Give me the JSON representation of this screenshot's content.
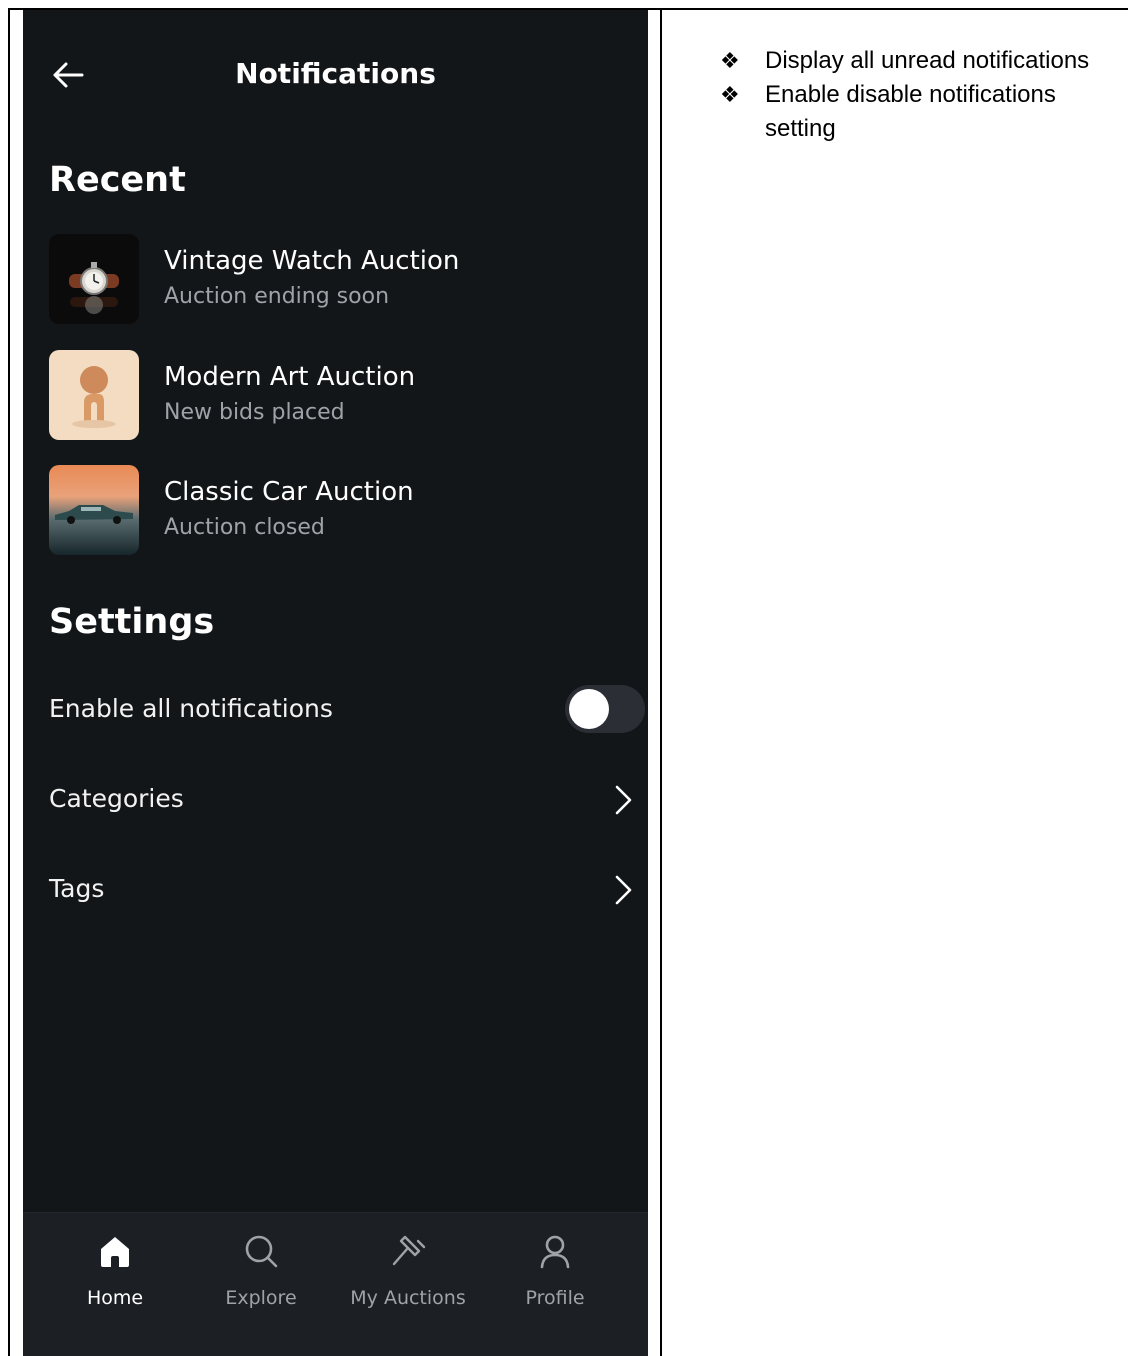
{
  "header": {
    "title": "Notifications"
  },
  "recent": {
    "heading": "Recent",
    "items": [
      {
        "title": "Vintage Watch Auction",
        "subtitle": "Auction ending soon",
        "thumb": "watch-thumbnail"
      },
      {
        "title": "Modern Art Auction",
        "subtitle": "New bids placed",
        "thumb": "art-thumbnail"
      },
      {
        "title": "Classic Car Auction",
        "subtitle": "Auction closed",
        "thumb": "car-thumbnail"
      }
    ]
  },
  "settings": {
    "heading": "Settings",
    "enable_all": {
      "label": "Enable all notifications",
      "on": false
    },
    "categories_label": "Categories",
    "tags_label": "Tags"
  },
  "nav": {
    "active": "Home",
    "items": [
      {
        "label": "Home",
        "icon": "home-icon"
      },
      {
        "label": "Explore",
        "icon": "search-icon"
      },
      {
        "label": "My Auctions",
        "icon": "gavel-icon"
      },
      {
        "label": "Profile",
        "icon": "user-icon"
      }
    ]
  },
  "notes": [
    {
      "bullet": "❖",
      "text": "Display all unread notifications"
    },
    {
      "bullet": "❖",
      "text": "Enable disable notifications setting"
    }
  ]
}
